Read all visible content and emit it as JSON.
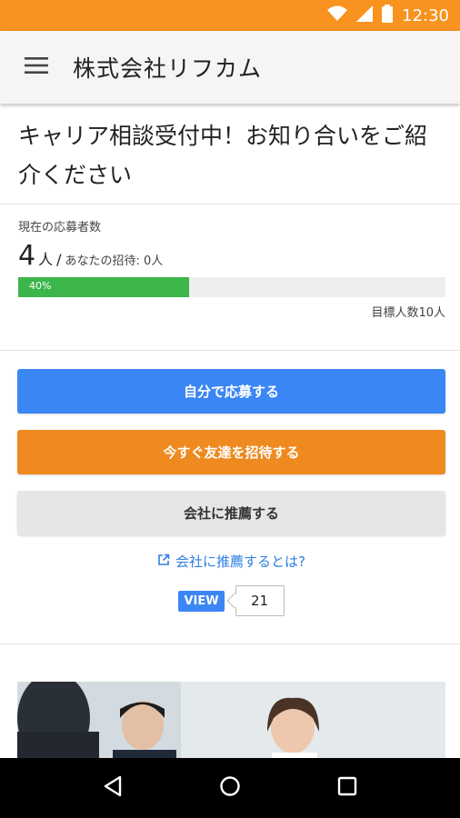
{
  "status_bar": {
    "time": "12:30",
    "background_color": "#f7931e",
    "icons": [
      "wifi-icon",
      "signal-icon",
      "battery-icon"
    ]
  },
  "app_bar": {
    "title": "株式会社リフカム",
    "menu_icon": "hamburger-menu-icon"
  },
  "headline": "キャリア相談受付中！お知り合いをご紹介ください",
  "stats": {
    "label": "現在の応募者数",
    "count": "4",
    "unit": "人",
    "slash": "/",
    "invite_text": "あなたの招待: 0人",
    "progress_percent": 40,
    "progress_label": "40%",
    "goal_text": "目標人数10人",
    "progress_color": "#3cb54a"
  },
  "actions": {
    "apply_label": "自分で応募する",
    "invite_label": "今すぐ友達を招待する",
    "recommend_label": "会社に推薦する",
    "learn_link": "会社に推薦するとは?",
    "view_badge": "VIEW",
    "view_count": "21"
  },
  "colors": {
    "primary_blue": "#3b86f5",
    "accent_orange": "#ee8a1f",
    "link_blue": "#2f7fe0"
  },
  "nav_bar": {
    "icons": [
      "back-icon",
      "home-icon",
      "recents-icon"
    ]
  }
}
